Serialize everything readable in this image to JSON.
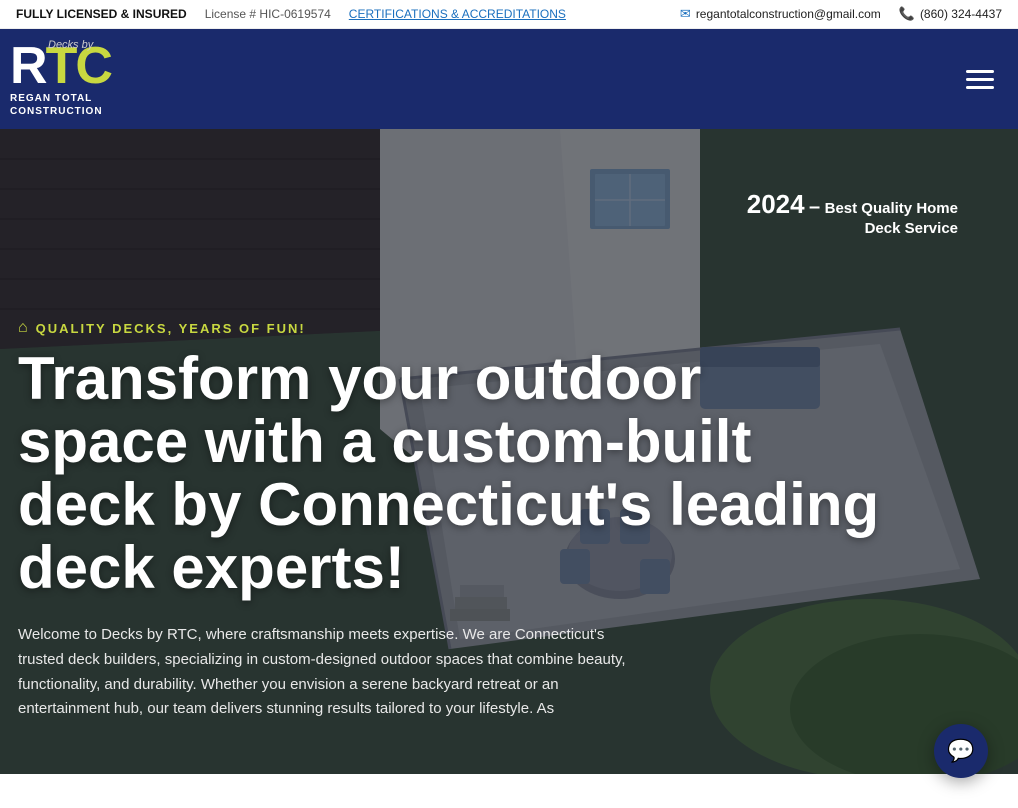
{
  "topbar": {
    "licensed_label": "FULLY LICENSED & INSURED",
    "license_number": "License # HIC-0619574",
    "cert_link": "CERTIFICATIONS & ACCREDITATIONS",
    "email": "regantotalconstruction@gmail.com",
    "phone": "(860) 324-4437"
  },
  "navbar": {
    "brand_top": "Decks by",
    "brand_main": "RTC",
    "brand_sub1": "REGAN TOTAL",
    "brand_sub2": "CONSTRUCTION",
    "menu_icon": "☰"
  },
  "hero": {
    "award_year": "2024",
    "award_dash": "–",
    "award_title": "Best Quality Home",
    "award_subtitle": "Deck Service",
    "tagline": "QUALITY DECKS, YEARS OF FUN!",
    "headline": "Transform your outdoor space with a custom-built deck by Connecticut's leading deck experts!",
    "description": "Welcome to Decks by RTC, where craftsmanship meets expertise. We are Connecticut's trusted deck builders, specializing in custom-designed outdoor spaces that combine beauty, functionality, and durability. Whether you envision a serene backyard retreat or an entertainment hub, our team delivers stunning results tailored to your lifestyle. As"
  },
  "chat": {
    "icon": "💬"
  }
}
